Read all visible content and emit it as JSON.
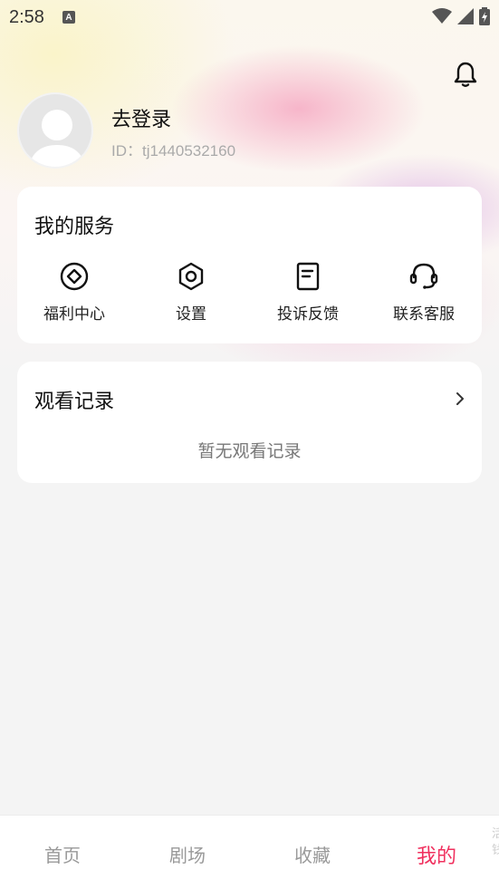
{
  "status_bar": {
    "time": "2:58",
    "notification_glyph": "A"
  },
  "profile": {
    "login_label": "去登录",
    "user_id": "ID：tj1440532160"
  },
  "services": {
    "title": "我的服务",
    "items": [
      {
        "label": "福利中心",
        "icon": "diamond-coin-icon"
      },
      {
        "label": "设置",
        "icon": "hex-nut-icon"
      },
      {
        "label": "投诉反馈",
        "icon": "document-icon"
      },
      {
        "label": "联系客服",
        "icon": "headset-icon"
      }
    ]
  },
  "history": {
    "title": "观看记录",
    "empty_text": "暂无观看记录"
  },
  "tabbar": {
    "tabs": [
      "首页",
      "剧场",
      "收藏",
      "我的"
    ],
    "active_index": 3,
    "peek_text": "活钱"
  },
  "colors": {
    "accent": "#f0305e",
    "tab_inactive": "#999999",
    "background": "#f4f4f4"
  }
}
